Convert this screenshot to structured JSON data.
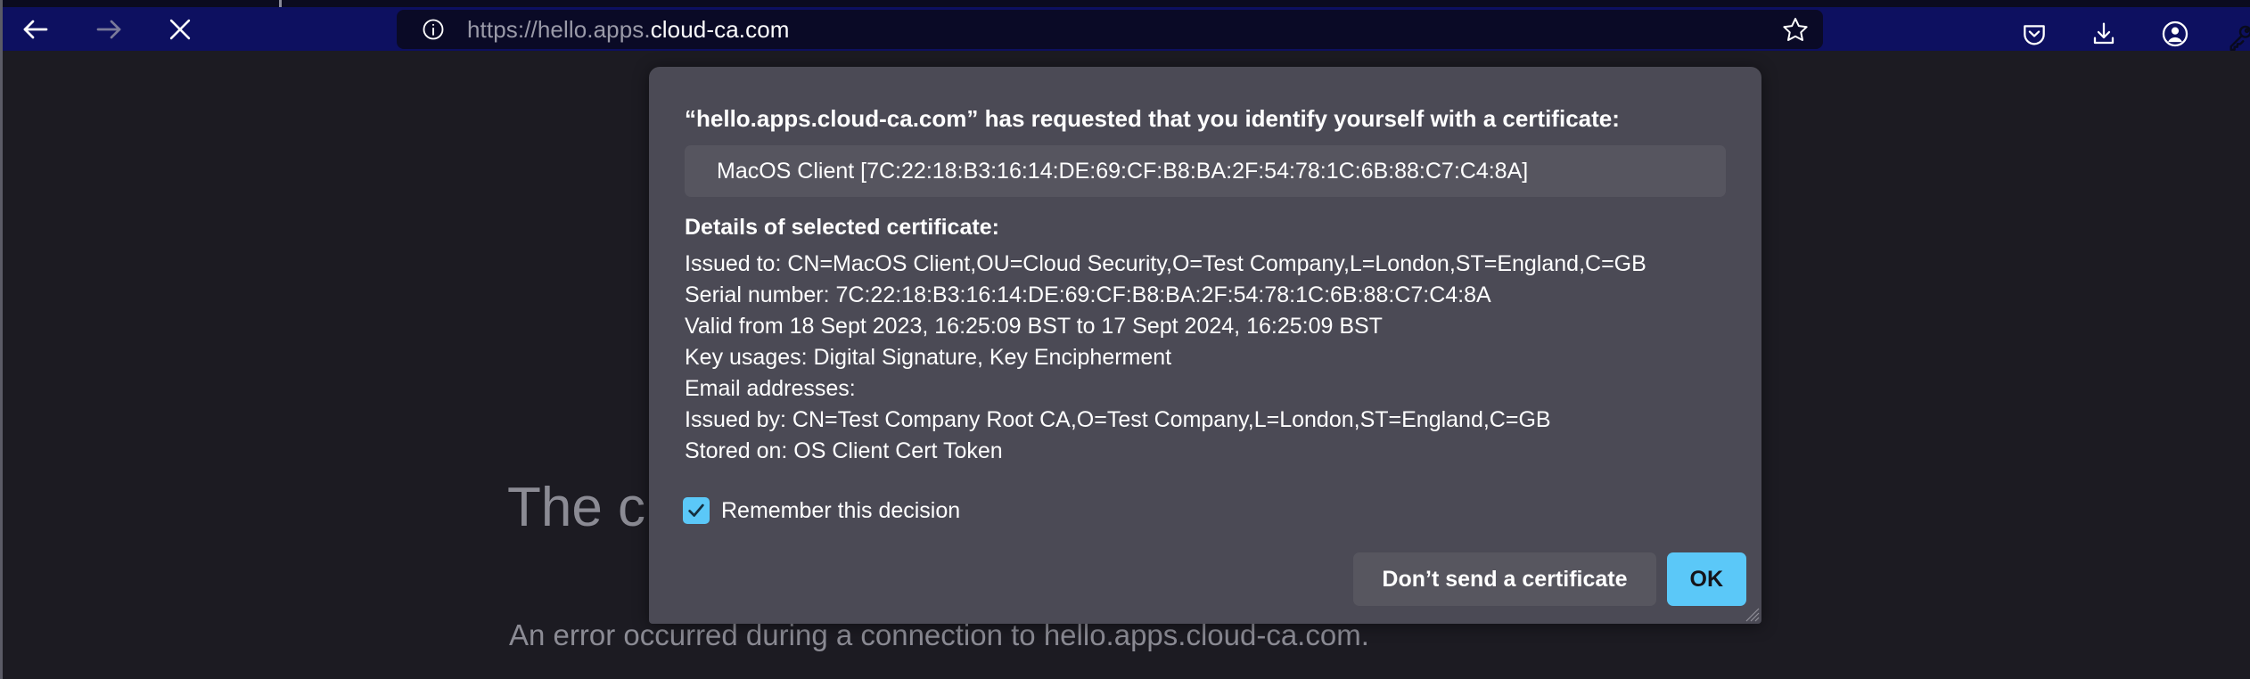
{
  "browser": {
    "nav": {
      "back_label": "Back",
      "forward_label": "Forward",
      "stop_label": "Stop"
    },
    "urlbar": {
      "identity_icon": "info-circle-icon",
      "url_prefix": "https://hello.apps.",
      "url_domain": "cloud-ca.com",
      "full_url": "https://hello.apps.cloud-ca.com",
      "bookmark_label": "Bookmark this page"
    },
    "toolbar_icons": [
      {
        "name": "pocket-icon",
        "label": "Save to Pocket"
      },
      {
        "name": "downloads-icon",
        "label": "Downloads"
      },
      {
        "name": "account-icon",
        "label": "Account"
      },
      {
        "name": "key-icon",
        "label": "Passwords"
      }
    ]
  },
  "page": {
    "heading": "The c",
    "subtext": "An error occurred during a connection to hello.apps.cloud-ca.com."
  },
  "dialog": {
    "title": "“hello.apps.cloud-ca.com” has requested that you identify yourself with a certificate:",
    "selected_certificate": "MacOS Client [7C:22:18:B3:16:14:DE:69:CF:B8:BA:2F:54:78:1C:6B:88:C7:C4:8A]",
    "details_heading": "Details of selected certificate:",
    "details": [
      "Issued to: CN=MacOS Client,OU=Cloud Security,O=Test Company,L=London,ST=England,C=GB",
      "Serial number: 7C:22:18:B3:16:14:DE:69:CF:B8:BA:2F:54:78:1C:6B:88:C7:C4:8A",
      "Valid from 18 Sept 2023, 16:25:09 BST to 17 Sept 2024, 16:25:09 BST",
      "Key usages: Digital Signature, Key Encipherment",
      "Email addresses:",
      "Issued by: CN=Test Company Root CA,O=Test Company,L=London,ST=England,C=GB",
      "Stored on: OS Client Cert Token"
    ],
    "remember_label": "Remember this decision",
    "remember_checked": true,
    "cancel_label": "Don’t send a certificate",
    "ok_label": "OK"
  },
  "colors": {
    "chrome_navbar": "#0d1060",
    "urlbar_bg": "#0a0a26",
    "page_bg": "#1c1b22",
    "dialog_bg": "#4b4a55",
    "dialog_field_bg": "#56555f",
    "accent": "#5bc8f8",
    "text_primary": "#ffffff",
    "text_muted": "#8b8b94"
  }
}
